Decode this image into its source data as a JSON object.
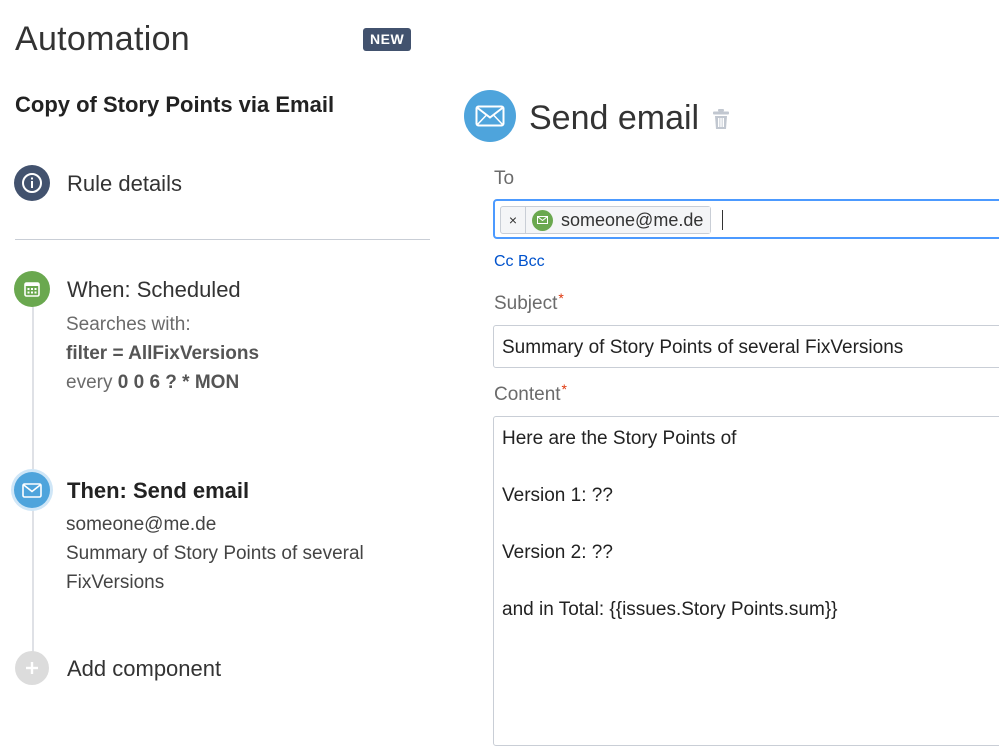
{
  "app": {
    "title": "Automation",
    "badge": "NEW"
  },
  "rule": {
    "name": "Copy of Story Points via Email",
    "details_label": "Rule details"
  },
  "trigger": {
    "title": "When: Scheduled",
    "searches_label": "Searches with:",
    "filter": "filter = AllFixVersions",
    "every_prefix": "every",
    "cron": "0 0 6 ? * MON",
    "icon": "calendar-icon",
    "color": "#6aa84f"
  },
  "action": {
    "title": "Then: Send email",
    "recipient": "someone@me.de",
    "subject_line1": "Summary of Story Points of several",
    "subject_line2": "FixVersions",
    "icon": "envelope-icon",
    "color": "#4ea4dc"
  },
  "add_component": {
    "label": "Add component",
    "icon": "plus-icon"
  },
  "panel": {
    "title": "Send email",
    "delete_icon": "trash-icon",
    "to_label": "To",
    "to_recipients": [
      {
        "remove": "×",
        "email": "someone@me.de"
      }
    ],
    "cc_bcc": "Cc Bcc",
    "subject_label": "Subject",
    "required_marker": "*",
    "subject_value": "Summary of Story Points of several FixVersions",
    "content_label": "Content",
    "content_lines": [
      "Here are the Story Points of",
      "Version 1: ??",
      "Version 2: ??",
      "and in Total: {{issues.Story Points.sum}}"
    ]
  },
  "colors": {
    "accent_blue": "#4ea4dc",
    "focus_border": "#4c9aff",
    "link": "#0052cc",
    "badge_bg": "#42526e",
    "required": "#de350b"
  }
}
